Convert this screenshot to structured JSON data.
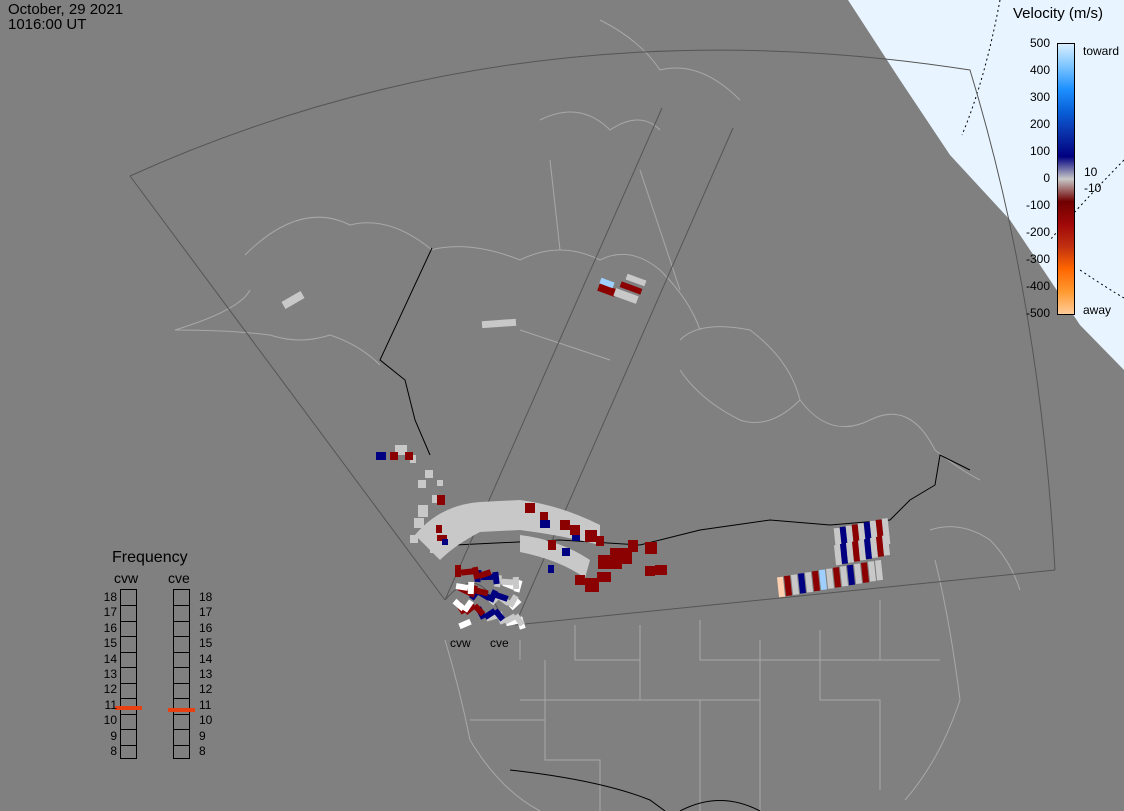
{
  "timestamp": {
    "date": "October, 29 2021",
    "time": "1016:00 UT"
  },
  "colorbar": {
    "title": "Velocity (m/s)",
    "ticks": [
      "500",
      "400",
      "300",
      "200",
      "100",
      "0",
      "-100",
      "-200",
      "-300",
      "-400",
      "-500"
    ],
    "extra_labels": {
      "plus": "10",
      "minus": "-10"
    },
    "toward_label": "toward",
    "away_label": "away",
    "colors": [
      "#d8eeff",
      "#7cc4ff",
      "#1e90ff",
      "#0860d8",
      "#0a2fa8",
      "#000080",
      "#c8c8c8",
      "#700000",
      "#a00808",
      "#c03010",
      "#ff6600",
      "#ff9a30",
      "#ffcc99"
    ]
  },
  "frequency": {
    "title": "Frequency",
    "radars": [
      {
        "name": "cvw",
        "value_mhz": 10.8
      },
      {
        "name": "cve",
        "value_mhz": 10.7
      }
    ],
    "levels": [
      "18",
      "17",
      "16",
      "15",
      "14",
      "13",
      "12",
      "11",
      "10",
      "9",
      "8"
    ],
    "marker_color": "#e84010"
  },
  "radar_labels": [
    "cvw",
    "cve"
  ],
  "map": {
    "land_color": "#808080",
    "daylight_color": "#e8f4ff",
    "fov_color": "#555555",
    "coast_color": "#a8a8a8",
    "border_color": "#000000"
  }
}
